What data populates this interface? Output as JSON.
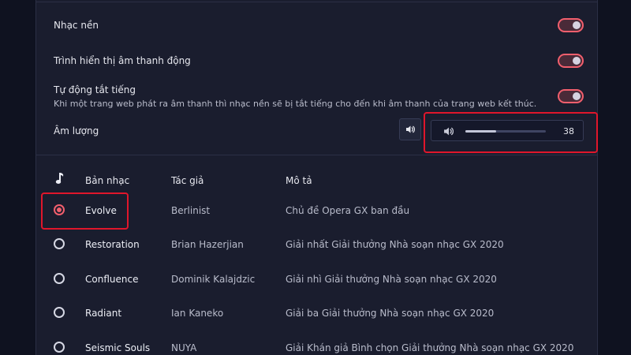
{
  "settings": {
    "background_music": {
      "label": "Nhạc nền",
      "enabled": true
    },
    "dynamic_visualizer": {
      "label": "Trình hiển thị âm thanh động",
      "enabled": true
    },
    "auto_mute": {
      "label": "Tự động tắt tiếng",
      "description": "Khi một trang web phát ra âm thanh thì nhạc nền sẽ bị tắt tiếng cho đến khi âm thanh của trang web kết thúc.",
      "enabled": true
    },
    "volume": {
      "label": "Âm lượng",
      "value": "38",
      "level_percent": 38
    }
  },
  "table": {
    "headers": {
      "track": "Bản nhạc",
      "author": "Tác giả",
      "description": "Mô tả"
    },
    "rows": [
      {
        "title": "Evolve",
        "author": "Berlinist",
        "description": "Chủ đề Opera GX ban đầu",
        "selected": true
      },
      {
        "title": "Restoration",
        "author": "Brian Hazerjian",
        "description": "Giải nhất Giải thưởng Nhà soạn nhạc GX 2020",
        "selected": false
      },
      {
        "title": "Confluence",
        "author": "Dominik Kalajdzic",
        "description": "Giải nhì Giải thưởng Nhà soạn nhạc GX 2020",
        "selected": false
      },
      {
        "title": "Radiant",
        "author": "Ian Kaneko",
        "description": "Giải ba Giải thưởng Nhà soạn nhạc GX 2020",
        "selected": false
      },
      {
        "title": "Seismic Souls",
        "author": "NUYA",
        "description": "Giải Khán giả Bình chọn Giải thưởng Nhà soạn nhạc GX 2020",
        "selected": false
      }
    ]
  },
  "icons": {
    "music_note": "music-note-icon",
    "speaker": "speaker-icon"
  },
  "colors": {
    "accent": "#f25f6d",
    "annotation": "#e0162b",
    "panel": "#1a1d2e",
    "background": "#0f1220"
  }
}
